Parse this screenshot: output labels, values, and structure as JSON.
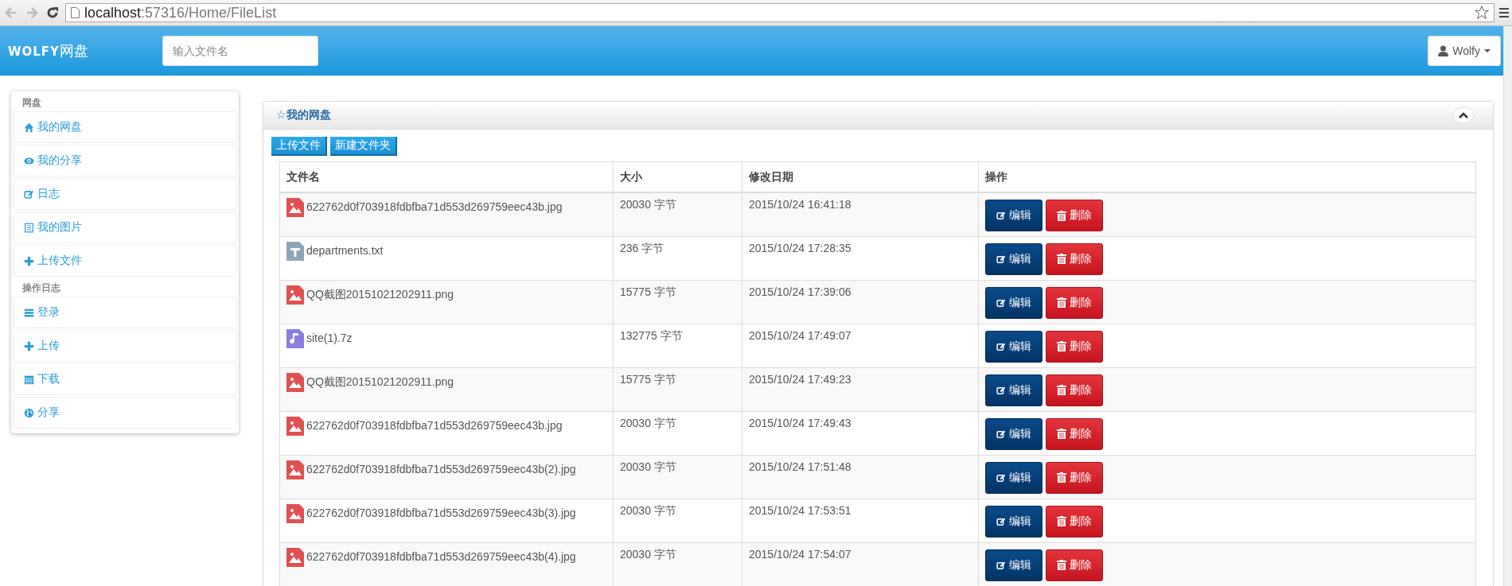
{
  "browser": {
    "address_host": "localhost",
    "address_path": ":57316/Home/FileList"
  },
  "header": {
    "brand": "WOLFY",
    "brand_suffix": "网盘",
    "search": {
      "placeholder": "输入文件名"
    },
    "user_menu": "Wolfy"
  },
  "sidebar": [
    {
      "heading": "网盘",
      "items": [
        {
          "label": "我的网盘"
        },
        {
          "label": "我的分享"
        },
        {
          "label": "日志"
        },
        {
          "label": "我的图片"
        },
        {
          "label": "上传文件"
        }
      ]
    },
    {
      "heading": "操作日志",
      "items": [
        {
          "label": "登录"
        },
        {
          "label": "上传"
        },
        {
          "label": "下载"
        },
        {
          "label": "分享"
        }
      ]
    }
  ],
  "panel": {
    "title": "☆我的网盘",
    "expanded": true,
    "toolbar": [
      "上传文件",
      "新建文件夹"
    ],
    "table": {
      "columns": [
        "文件名",
        "大小",
        "修改日期",
        "操作"
      ],
      "rows": [
        {
          "kind": "image",
          "name": "622762d0f703918fdbfba71d553d269759eec43b.jpg",
          "size": "20030 字节",
          "modified": "2015/10/24 16:41:18",
          "actions": [
            {
              "kind": "edit",
              "label": "编辑"
            },
            {
              "kind": "delete",
              "label": "删除"
            }
          ]
        },
        {
          "kind": "text",
          "name": "departments.txt",
          "size": "236 字节",
          "modified": "2015/10/24 17:28:35",
          "actions": [
            {
              "kind": "edit",
              "label": "编辑"
            },
            {
              "kind": "delete",
              "label": "删除"
            }
          ]
        },
        {
          "kind": "image",
          "name": "QQ截图20151021202911.png",
          "size": "15775 字节",
          "modified": "2015/10/24 17:39:06",
          "actions": [
            {
              "kind": "edit",
              "label": "编辑"
            },
            {
              "kind": "delete",
              "label": "删除"
            }
          ]
        },
        {
          "kind": "audio",
          "name": "site(1).7z",
          "size": "132775 字节",
          "modified": "2015/10/24 17:49:07",
          "actions": [
            {
              "kind": "edit",
              "label": "编辑"
            },
            {
              "kind": "delete",
              "label": "删除"
            }
          ]
        },
        {
          "kind": "image",
          "name": "QQ截图20151021202911.png",
          "size": "15775 字节",
          "modified": "2015/10/24 17:49:23",
          "actions": [
            {
              "kind": "edit",
              "label": "编辑"
            },
            {
              "kind": "delete",
              "label": "删除"
            }
          ]
        },
        {
          "kind": "image",
          "name": "622762d0f703918fdbfba71d553d269759eec43b.jpg",
          "size": "20030 字节",
          "modified": "2015/10/24 17:49:43",
          "actions": [
            {
              "kind": "edit",
              "label": "编辑"
            },
            {
              "kind": "delete",
              "label": "删除"
            }
          ]
        },
        {
          "kind": "image",
          "name": "622762d0f703918fdbfba71d553d269759eec43b(2).jpg",
          "size": "20030 字节",
          "modified": "2015/10/24 17:51:48",
          "actions": [
            {
              "kind": "edit",
              "label": "编辑"
            },
            {
              "kind": "delete",
              "label": "删除"
            }
          ]
        },
        {
          "kind": "image",
          "name": "622762d0f703918fdbfba71d553d269759eec43b(3).jpg",
          "size": "20030 字节",
          "modified": "2015/10/24 17:53:51",
          "actions": [
            {
              "kind": "edit",
              "label": "编辑"
            },
            {
              "kind": "delete",
              "label": "删除"
            }
          ]
        },
        {
          "kind": "image",
          "name": "622762d0f703918fdbfba71d553d269759eec43b(4).jpg",
          "size": "20030 字节",
          "modified": "2015/10/24 17:54:07",
          "actions": [
            {
              "kind": "edit",
              "label": "编辑"
            },
            {
              "kind": "delete",
              "label": "删除"
            }
          ]
        }
      ]
    }
  }
}
